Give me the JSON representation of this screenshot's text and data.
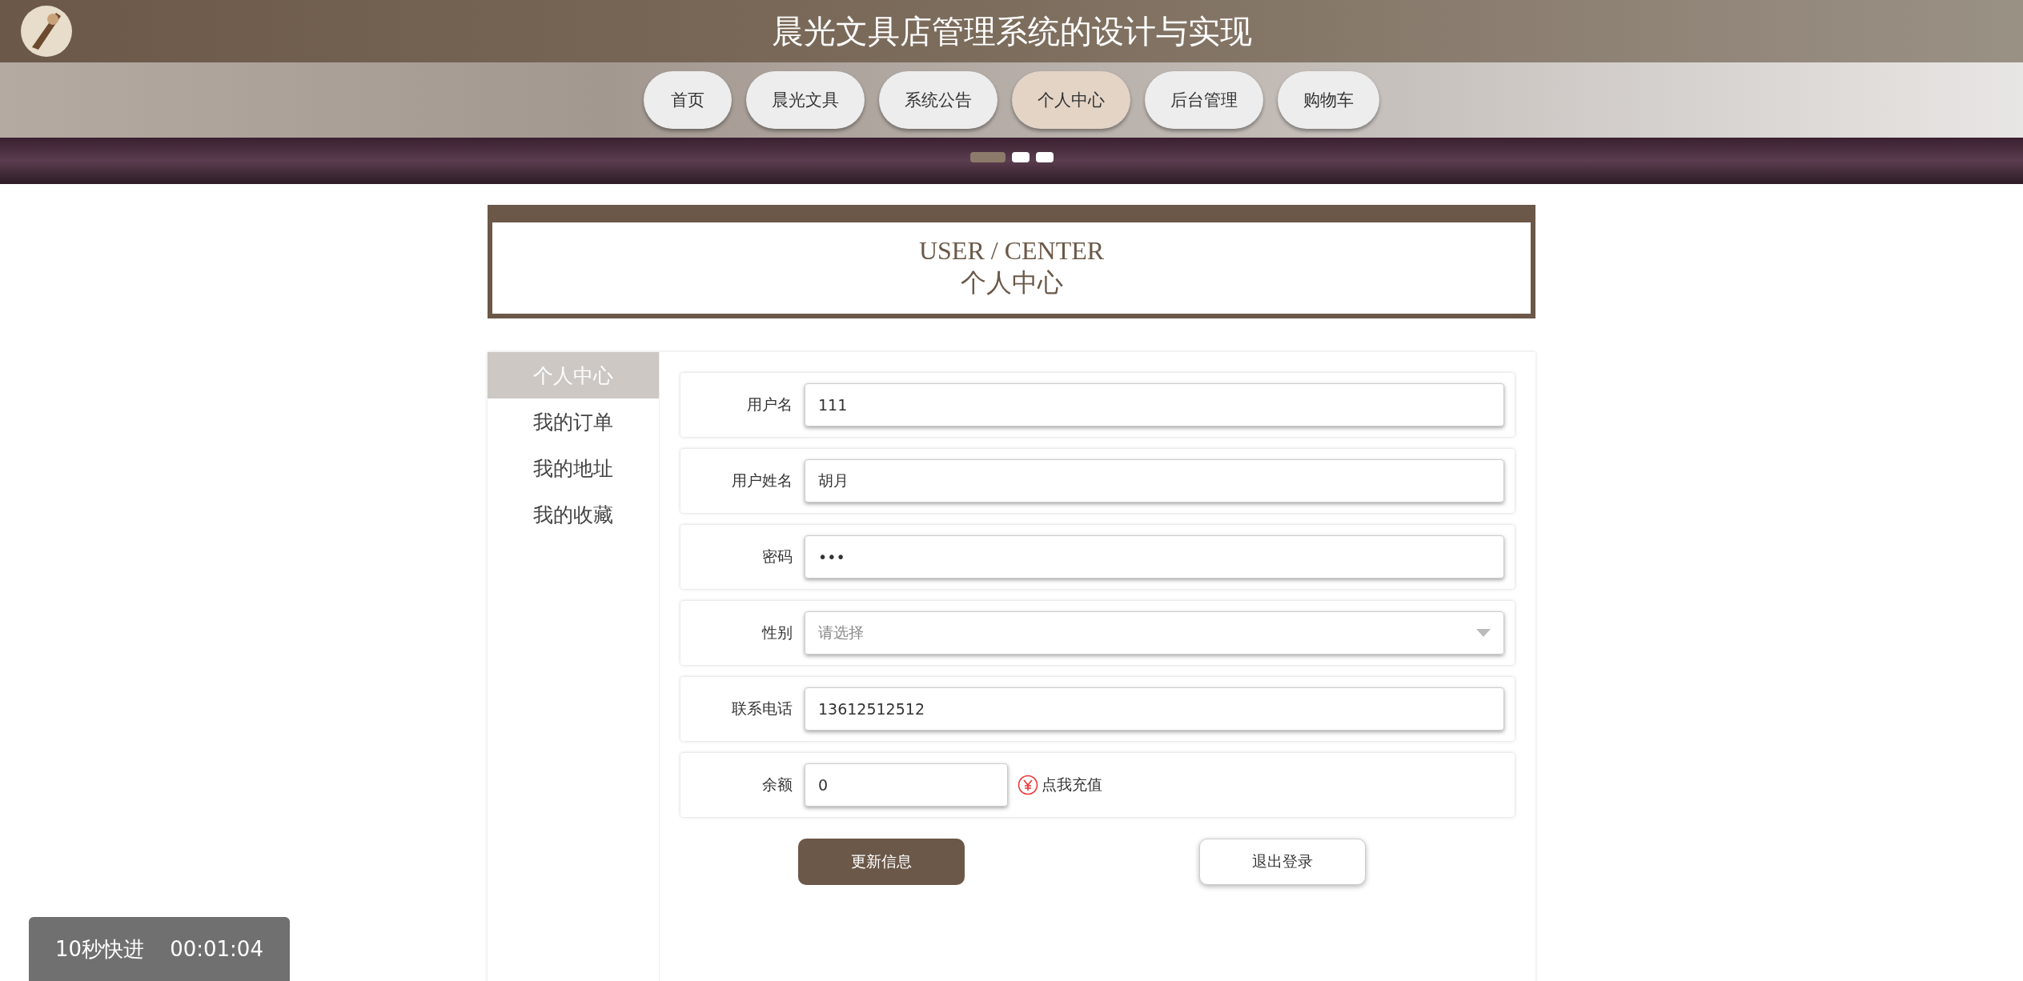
{
  "header": {
    "title": "晨光文具店管理系统的设计与实现"
  },
  "nav": [
    {
      "label": "首页",
      "selected": false
    },
    {
      "label": "晨光文具",
      "selected": false
    },
    {
      "label": "系统公告",
      "selected": false
    },
    {
      "label": "个人中心",
      "selected": true
    },
    {
      "label": "后台管理",
      "selected": false
    },
    {
      "label": "购物车",
      "selected": false
    }
  ],
  "carousel_dots": [
    {
      "selected": true
    },
    {
      "selected": false
    },
    {
      "selected": false
    }
  ],
  "section_title": {
    "english": "USER / CENTER",
    "chinese": "个人中心"
  },
  "sidebar": {
    "items": [
      {
        "label": "个人中心",
        "selected": true
      },
      {
        "label": "我的订单",
        "selected": false
      },
      {
        "label": "我的地址",
        "selected": false
      },
      {
        "label": "我的收藏",
        "selected": false
      }
    ]
  },
  "form": {
    "fields": [
      {
        "kind": "text",
        "label": "用户名",
        "value": "111"
      },
      {
        "kind": "text",
        "label": "用户姓名",
        "value": "胡月"
      },
      {
        "kind": "password",
        "label": "密码",
        "value": "•••"
      },
      {
        "kind": "select",
        "label": "性别",
        "placeholder": "请选择"
      },
      {
        "kind": "text",
        "label": "联系电话",
        "value": "13612512512"
      },
      {
        "kind": "balance",
        "label": "余额",
        "value": "0",
        "link": "点我充值"
      }
    ],
    "buttons": [
      {
        "kind": "primary",
        "label": "更新信息"
      },
      {
        "kind": "secondary",
        "label": "退出登录"
      }
    ]
  },
  "video_overlay": {
    "label": "10秒快进",
    "time": "00:01:04"
  }
}
